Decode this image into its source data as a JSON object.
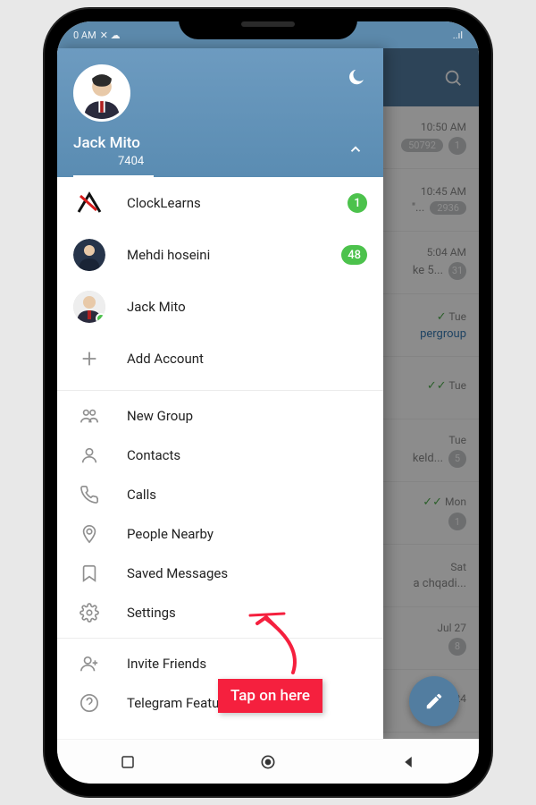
{
  "status": {
    "time_left": "0 AM",
    "icons_right": "..ıl"
  },
  "drawer": {
    "name": "Jack Mito",
    "phone": "7404",
    "accounts": [
      {
        "label": "ClockLearns",
        "badge": "1"
      },
      {
        "label": "Mehdi hoseini",
        "badge": "48"
      },
      {
        "label": "Jack Mito",
        "badge": ""
      }
    ],
    "add_account": "Add Account",
    "menu": {
      "new_group": "New Group",
      "contacts": "Contacts",
      "calls": "Calls",
      "people_nearby": "People Nearby",
      "saved_messages": "Saved Messages",
      "settings": "Settings",
      "invite_friends": "Invite Friends",
      "telegram_features": "Telegram Features"
    }
  },
  "bg": {
    "rows": [
      {
        "time": "10:50 AM",
        "badge": "50792",
        "unread": "1",
        "checks": "",
        "preview": ""
      },
      {
        "time": "10:45 AM",
        "badge": "2936",
        "unread": "",
        "checks": "",
        "preview": "\"..."
      },
      {
        "time": "5:04 AM",
        "badge": "",
        "unread": "31",
        "checks": "",
        "preview": "ke 5..."
      },
      {
        "time": "Tue",
        "badge": "",
        "unread": "",
        "checks": "✓",
        "preview": "pergroup"
      },
      {
        "time": "Tue",
        "badge": "",
        "unread": "",
        "checks": "✓✓",
        "preview": ""
      },
      {
        "time": "Tue",
        "badge": "",
        "unread": "5",
        "checks": "",
        "preview": "keld..."
      },
      {
        "time": "Mon",
        "badge": "",
        "unread": "1",
        "checks": "✓✓",
        "preview": ""
      },
      {
        "time": "Sat",
        "badge": "",
        "unread": "",
        "checks": "",
        "preview": "a chqadi..."
      },
      {
        "time": "Jul 27",
        "badge": "",
        "unread": "8",
        "checks": "",
        "preview": ""
      },
      {
        "time": "24",
        "badge": "",
        "unread": "",
        "checks": "✓✓",
        "preview": ""
      }
    ]
  },
  "annotation": {
    "label": "Tap on here"
  }
}
